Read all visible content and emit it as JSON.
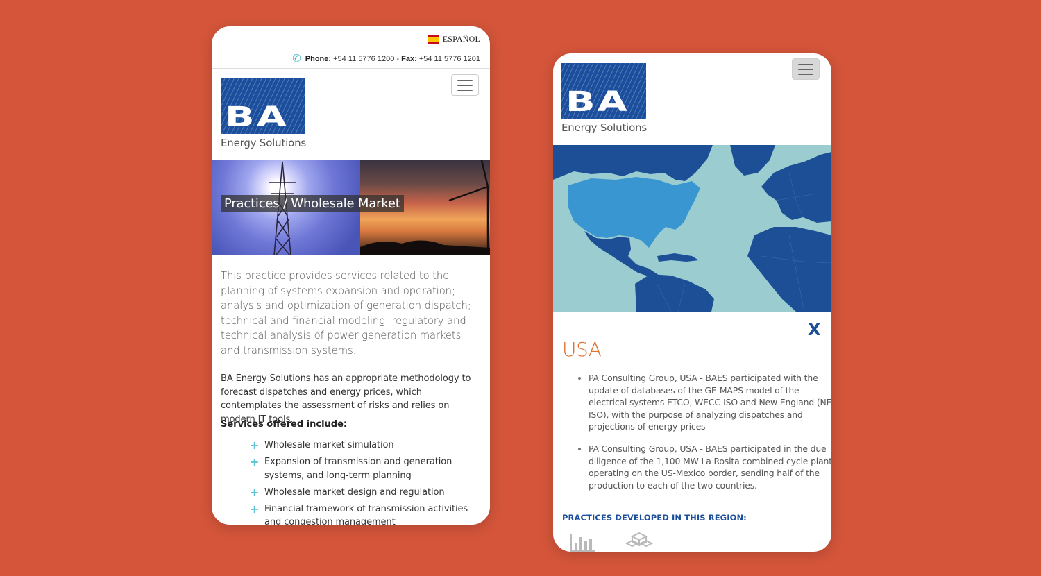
{
  "left_screen": {
    "language": {
      "label": "ESPAÑOL",
      "flag_icon": "spain-flag-icon"
    },
    "contact": {
      "phone_label": "Phone:",
      "phone_value": "+54 11 5776 1200 -",
      "fax_label": "Fax:",
      "fax_value": "+54 11 5776 1201"
    },
    "logo": {
      "letters": "BA",
      "subtitle": "Energy Solutions"
    },
    "banner_title": "Practices / Wholesale Market",
    "intro": "This practice provides services related to the planning of systems expansion and operation; analysis and optimization of generation dispatch; technical and financial modeling; regulatory and technical analysis of power generation markets and transmission systems.",
    "body": "BA Energy Solutions has an appropriate methodology to forecast dispatches and energy prices, which contemplates the assessment of risks and relies on modern IT tools.",
    "services_heading": "Services offered include:",
    "services": [
      "Wholesale market simulation",
      "Expansion of transmission and generation systems, and long-term planning",
      "Wholesale market design and regulation",
      "Financial framework of transmission activities and congestion management"
    ]
  },
  "right_screen": {
    "logo": {
      "letters": "BA",
      "subtitle": "Energy Solutions"
    },
    "close_label": "X",
    "region_title": "USA",
    "projects": [
      "PA Consulting Group, USA - BAES participated with the update of databases of the GE-MAPS model of the electrical systems ETCO, WECC-ISO and New England (NE-ISO), with the purpose of analyzing dispatches and projections of energy prices",
      "PA Consulting Group, USA - BAES participated in the due diligence of the 1,100 MW La Rosita combined cycle plant, operating on the US-Mexico border, sending half of the production to each of the two countries."
    ],
    "practices_heading": "PRACTICES DEVELOPED IN THIS REGION:",
    "practice_icons": [
      "bar-chart-icon",
      "cubes-icon"
    ]
  },
  "colors": {
    "background": "#d4553a",
    "brand_blue": "#1b4e9c",
    "accent_orange": "#e0702e",
    "accent_teal": "#5bc3d4",
    "map_sea": "#9bcdd0",
    "map_land": "#1d4f97",
    "map_highlight": "#3a96d0"
  }
}
